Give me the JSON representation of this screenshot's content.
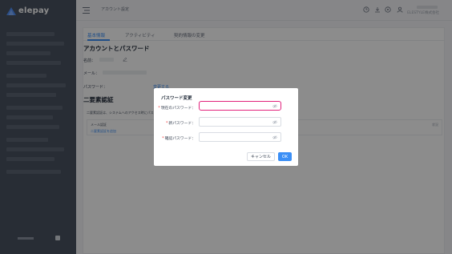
{
  "app": {
    "logo": "elepay"
  },
  "topbar": {
    "title": "アカウント設定",
    "company": "ELESTYLE株式会社",
    "icons": [
      "clock-icon",
      "download-icon",
      "help-icon",
      "user-icon"
    ]
  },
  "tabs": [
    {
      "label": "基本情報",
      "active": true
    },
    {
      "label": "アクティビティ",
      "active": false
    },
    {
      "label": "契約情報の変更",
      "active": false
    }
  ],
  "account": {
    "section_title": "アカウントとパスワード",
    "name_label": "名前：",
    "email_label": "メール：",
    "password_label": "パスワード：",
    "password_link": "変更する"
  },
  "mfa": {
    "section_title": "二要素認証",
    "description": "二要素認証は、システムへのアクセス時にパスワ",
    "column_label": "メール認証",
    "link": "二要素認証を追加",
    "status_col": "状況"
  },
  "modal": {
    "title": "パスワード変更",
    "fields": [
      {
        "label": "現在のパスワード：",
        "required": true,
        "focused": true,
        "value": ""
      },
      {
        "label": "新パスワード：",
        "required": true,
        "focused": false,
        "value": ""
      },
      {
        "label": "確認パスワード：",
        "required": true,
        "focused": false,
        "value": ""
      }
    ],
    "cancel_label": "キャンセル",
    "ok_label": "OK"
  },
  "colors": {
    "accent": "#3b8ff6",
    "focus_border": "#e2227c",
    "sidebar": "#4a5361",
    "required": "#ef4444"
  }
}
